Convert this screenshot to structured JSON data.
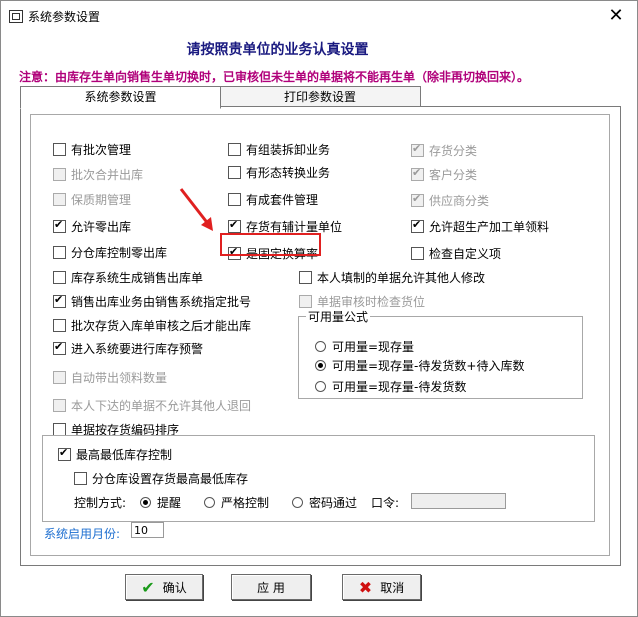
{
  "window": {
    "title": "系统参数设置",
    "close_label": "✕"
  },
  "heading": "请按照贵单位的业务认真设置",
  "notice": "注意：由库存生单向销售生单切换时，已审核但未生单的单据将不能再生单（除非再切换回来）。",
  "tabs": [
    {
      "label": "系统参数设置",
      "active": true
    },
    {
      "label": "打印参数设置",
      "active": false
    }
  ],
  "col1": [
    {
      "label": "有批次管理",
      "checked": false,
      "enabled": true
    },
    {
      "label": "批次合并出库",
      "checked": false,
      "enabled": false
    },
    {
      "label": "保质期管理",
      "checked": false,
      "enabled": false
    },
    {
      "label": "允许零出库",
      "checked": true,
      "enabled": true
    },
    {
      "label": "分仓库控制零出库",
      "checked": false,
      "enabled": true
    },
    {
      "label": "库存系统生成销售出库单",
      "checked": false,
      "enabled": true
    },
    {
      "label": "销售出库业务由销售系统指定批号",
      "checked": true,
      "enabled": true
    },
    {
      "label": "批次存货入库单审核之后才能出库",
      "checked": false,
      "enabled": true
    },
    {
      "label": "进入系统要进行库存预警",
      "checked": true,
      "enabled": true
    },
    {
      "label": "自动带出领料数量",
      "checked": false,
      "enabled": false
    },
    {
      "label": "本人下达的单据不允许其他人退回",
      "checked": false,
      "enabled": false
    },
    {
      "label": "单据按存货编码排序",
      "checked": false,
      "enabled": true
    }
  ],
  "col2": [
    {
      "label": "有组装拆卸业务",
      "checked": false,
      "enabled": true
    },
    {
      "label": "有形态转换业务",
      "checked": false,
      "enabled": true
    },
    {
      "label": "有成套件管理",
      "checked": false,
      "enabled": true
    },
    {
      "label": "存货有辅计量单位",
      "checked": true,
      "enabled": true
    },
    {
      "label": "是固定换算率",
      "checked": true,
      "enabled": true
    },
    {
      "label": "本人填制的单据允许其他人修改",
      "checked": false,
      "enabled": true
    },
    {
      "label": "单据审核时检查货位",
      "checked": false,
      "enabled": false
    }
  ],
  "col3": [
    {
      "label": "存货分类",
      "checked": true,
      "enabled": false
    },
    {
      "label": "客户分类",
      "checked": true,
      "enabled": false
    },
    {
      "label": "供应商分类",
      "checked": true,
      "enabled": false
    },
    {
      "label": "允许超生产加工单领料",
      "checked": true,
      "enabled": true
    },
    {
      "label": "检查自定义项",
      "checked": false,
      "enabled": true
    }
  ],
  "available_formula": {
    "legend": "可用量公式",
    "options": [
      {
        "label": "可用量=现存量",
        "selected": false
      },
      {
        "label": "可用量=现存量-待发货数+待入库数",
        "selected": true
      },
      {
        "label": "可用量=现存量-待发货数",
        "selected": false
      }
    ]
  },
  "stock_control": {
    "max_min": {
      "label": "最高最低库存控制",
      "checked": true
    },
    "by_warehouse": {
      "label": "分仓库设置存货最高最低库存",
      "checked": false
    },
    "mode_label": "控制方式:",
    "modes": [
      {
        "label": "提醒",
        "selected": true
      },
      {
        "label": "严格控制",
        "selected": false
      },
      {
        "label": "密码通过",
        "selected": false
      }
    ],
    "password_label": "口令:",
    "password_value": ""
  },
  "start_month": {
    "label": "系统启用月份:",
    "value": "10"
  },
  "buttons": {
    "ok": "确认",
    "apply": "应 用",
    "cancel": "取消"
  },
  "colors": {
    "heading": "#1a1a80",
    "notice": "#b0007a",
    "highlight": "#e02020",
    "ok_icon": "#1a9a1a",
    "cancel_icon": "#d01010"
  }
}
